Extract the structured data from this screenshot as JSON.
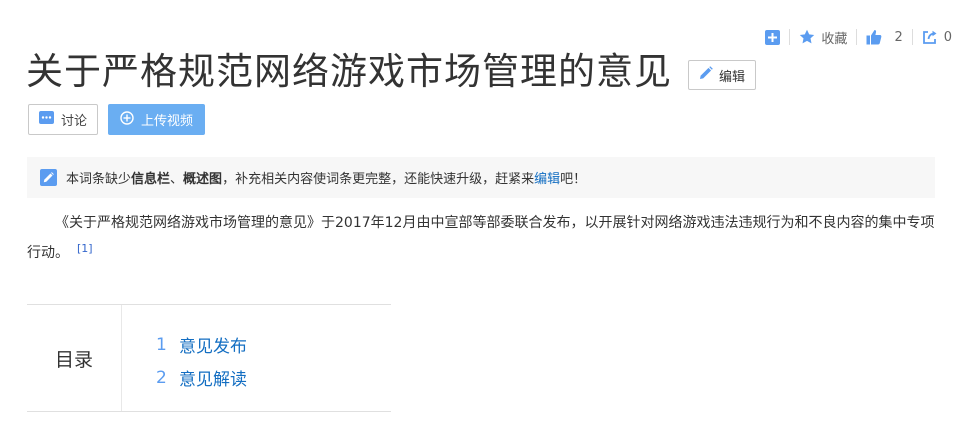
{
  "top_actions": {
    "favorite_label": "收藏",
    "like_count": "2",
    "share_count": "0"
  },
  "title": "关于严格规范网络游戏市场管理的意见",
  "edit_label": "编辑",
  "buttons": {
    "discuss": "讨论",
    "upload_video": "上传视频"
  },
  "notice": {
    "prefix": "本词条缺少",
    "missing_1": "信息栏",
    "sep": "、",
    "missing_2": "概述图",
    "middle": "，补充相关内容使词条更完整，还能快速升级，赶紧来",
    "link": "编辑",
    "suffix": "吧！"
  },
  "summary": {
    "text": "《关于严格规范网络游戏市场管理的意见》于2017年12月由中宣部等部委联合发布，以开展针对网络游戏违法违规行为和不良内容的集中专项行动。",
    "ref": "[1]"
  },
  "toc": {
    "heading": "目录",
    "items": [
      {
        "num": "1",
        "label": "意见发布"
      },
      {
        "num": "2",
        "label": "意见解读"
      }
    ]
  },
  "colors": {
    "accent": "#6aaef2",
    "link": "#136ec2",
    "icon_blue": "#5b9cf0"
  }
}
